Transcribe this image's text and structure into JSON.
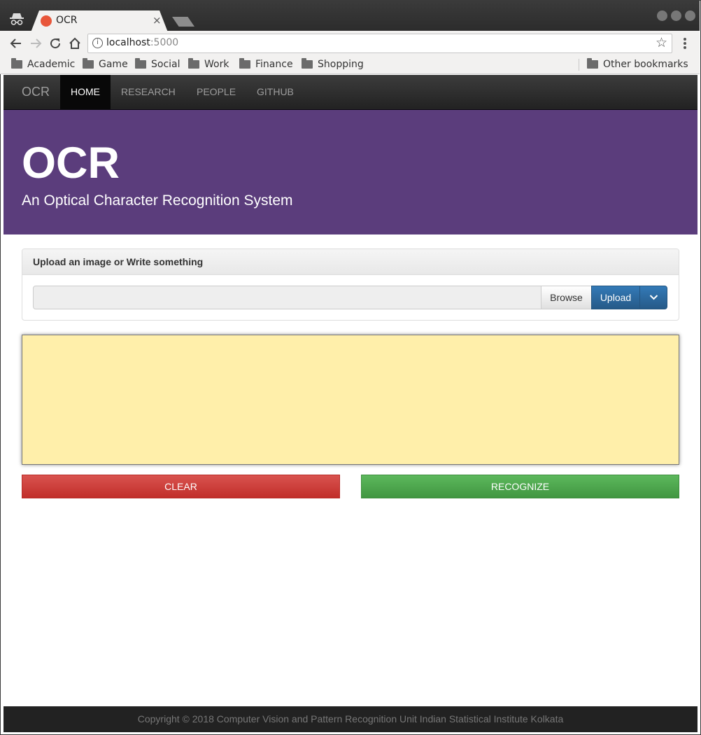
{
  "browser": {
    "tab_title": "OCR",
    "tab_close": "×",
    "url_host": "localhost",
    "url_port": ":5000",
    "info_glyph": "i",
    "star_glyph": "☆",
    "bookmarks": [
      "Academic",
      "Game",
      "Social",
      "Work",
      "Finance",
      "Shopping"
    ],
    "other_bookmarks": "Other bookmarks"
  },
  "navbar": {
    "brand": "OCR",
    "items": [
      "HOME",
      "RESEARCH",
      "PEOPLE",
      "GITHUB"
    ],
    "active": "HOME"
  },
  "jumbotron": {
    "title": "OCR",
    "subtitle": "An Optical Character Recognition System"
  },
  "upload_panel": {
    "heading": "Upload an image or Write something",
    "file_value": "",
    "browse_label": "Browse",
    "upload_label": "Upload"
  },
  "actions": {
    "clear_label": "CLEAR",
    "recognize_label": "RECOGNIZE"
  },
  "footer": {
    "copyright": "Copyright © 2018 Computer Vision and Pattern Recognition Unit Indian Statistical Institute Kolkata"
  },
  "colors": {
    "navbar": "#222222",
    "jumbotron": "#5b3d7c",
    "canvas": "#ffefaa",
    "clear": "#d9534f",
    "recognize": "#5cb85c",
    "upload": "#337ab7"
  }
}
